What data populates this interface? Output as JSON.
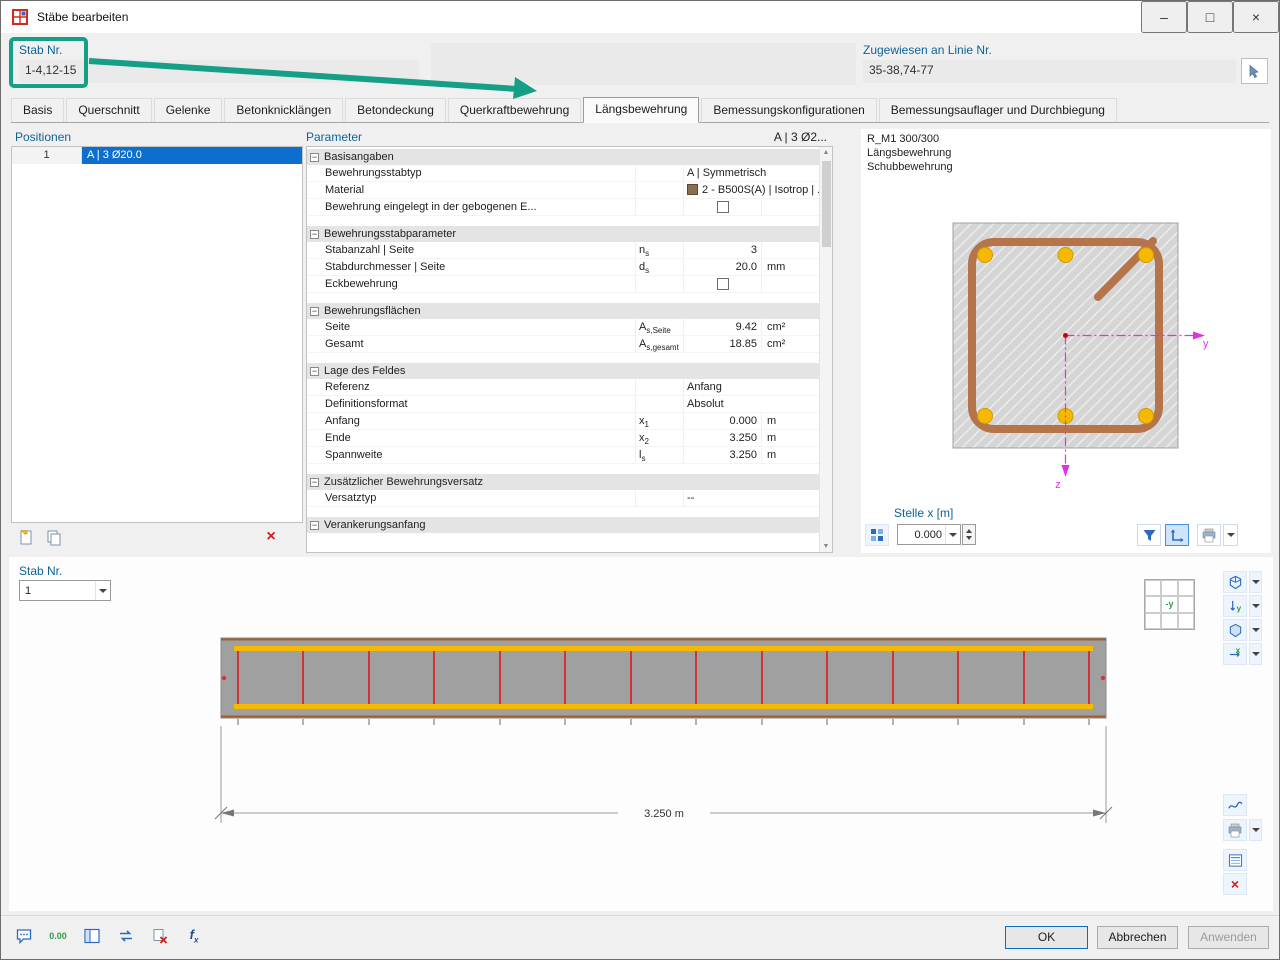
{
  "window": {
    "title": "Stäbe bearbeiten"
  },
  "header": {
    "stab_label": "Stab Nr.",
    "stab_value": "1-4,12-15",
    "assigned_label": "Zugewiesen an Linie Nr.",
    "assigned_value": "35-38,74-77"
  },
  "tabs": {
    "items": [
      "Basis",
      "Querschnitt",
      "Gelenke",
      "Betonknicklängen",
      "Betondeckung",
      "Querkraftbewehrung",
      "Längsbewehrung",
      "Bemessungskonfigurationen",
      "Bemessungsauflager und Durchbiegung"
    ],
    "active": "Längsbewehrung"
  },
  "positionen": {
    "title": "Positionen",
    "row_nr": "1",
    "row_desc": "A | 3 Ø20.0"
  },
  "parameter": {
    "title": "Parameter",
    "selection": "A | 3 Ø2...",
    "sections": {
      "s1": "Basisangaben",
      "s2": "Bewehrungsstabparameter",
      "s3": "Bewehrungsflächen",
      "s4": "Lage des Feldes",
      "s5": "Zusätzlicher Bewehrungsversatz",
      "s6": "Verankerungsanfang"
    },
    "rows": {
      "stabtyp": {
        "name": "Bewehrungsstabtyp",
        "value": "A | Symmetrisch"
      },
      "material": {
        "name": "Material",
        "value": "2 - B500S(A) | Isotrop | ..."
      },
      "gebogen": {
        "name": "Bewehrung eingelegt in der gebogenen E..."
      },
      "anzahl": {
        "name": "Stabanzahl | Seite",
        "sym": "n",
        "sub": "s",
        "value": "3",
        "unit": ""
      },
      "durchmesser": {
        "name": "Stabdurchmesser | Seite",
        "sym": "d",
        "sub": "s",
        "value": "20.0",
        "unit": "mm"
      },
      "eck": {
        "name": "Eckbewehrung"
      },
      "seite": {
        "name": "Seite",
        "sym": "A",
        "sub": "s,Seite",
        "value": "9.42",
        "unit": "cm²"
      },
      "gesamt": {
        "name": "Gesamt",
        "sym": "A",
        "sub": "s,gesamt",
        "value": "18.85",
        "unit": "cm²"
      },
      "referenz": {
        "name": "Referenz",
        "value": "Anfang"
      },
      "format": {
        "name": "Definitionsformat",
        "value": "Absolut"
      },
      "anfang": {
        "name": "Anfang",
        "sym": "x",
        "sub": "1",
        "value": "0.000",
        "unit": "m"
      },
      "ende": {
        "name": "Ende",
        "sym": "x",
        "sub": "2",
        "value": "3.250",
        "unit": "m"
      },
      "spannweite": {
        "name": "Spannweite",
        "sym": "l",
        "sub": "s",
        "value": "3.250",
        "unit": "m"
      },
      "versatz": {
        "name": "Versatztyp",
        "value": "--"
      }
    }
  },
  "section_view": {
    "line1": "R_M1 300/300",
    "line2": "Längsbewehrung",
    "line3": "Schubbewehrung",
    "axis_y": "y",
    "axis_z": "z",
    "stelle_label": "Stelle x [m]",
    "stelle_value": "0.000"
  },
  "bottom": {
    "stab_label": "Stab Nr.",
    "stab_value": "1",
    "dimension_label": "3.250 m",
    "view_cube_label": "-y"
  },
  "footer": {
    "ok": "OK",
    "cancel": "Abbrechen",
    "apply": "Anwenden"
  },
  "icons": {
    "minimize": "–",
    "maximize": "□",
    "close": "×",
    "delete_x": "×",
    "scroll_up": "▲",
    "scroll_down": "▼",
    "collapse": "−",
    "zoom_reset_x": "×"
  },
  "colors": {
    "annotation": "#159f86",
    "selection": "#0c6fce",
    "label_blue": "#0e6398",
    "rebar_yellow": "#f6b800",
    "stirrup_red": "#d03434",
    "stirrup_brown": "#b5744a",
    "axis_magenta": "#e62ee6"
  }
}
